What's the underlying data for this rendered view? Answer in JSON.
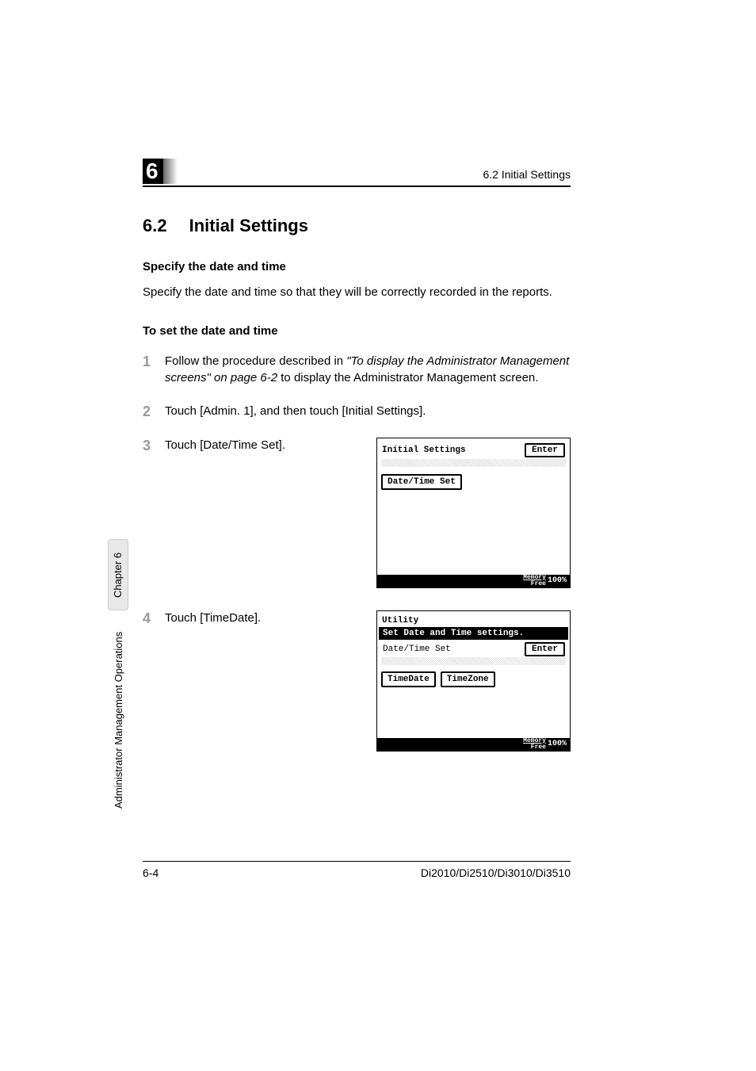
{
  "header": {
    "chapter_number": "6",
    "right_text": "6.2 Initial Settings"
  },
  "section": {
    "number": "6.2",
    "title": "Initial Settings"
  },
  "sub1": {
    "heading": "Specify the date and time",
    "text": "Specify the date and time so that they will be correctly recorded in the reports."
  },
  "sub2": {
    "heading": "To set the date and time"
  },
  "steps": {
    "s1": {
      "num": "1",
      "pre": "Follow the procedure described in ",
      "ital": "\"To display the Administrator Management screens\" on page 6-2",
      "post": " to display the Administrator Management screen."
    },
    "s2": {
      "num": "2",
      "text": "Touch [Admin. 1], and then touch [Initial Settings]."
    },
    "s3": {
      "num": "3",
      "text": "Touch [Date/Time Set]."
    },
    "s4": {
      "num": "4",
      "text": "Touch [TimeDate]."
    }
  },
  "lcd1": {
    "title": "Initial Settings",
    "enter": "Enter",
    "btn1": "Date/Time Set",
    "mem1": "Memory",
    "mem2": "Free",
    "pct": "100%"
  },
  "lcd2": {
    "title": "Utility",
    "bar": "Set Date and Time settings.",
    "subtitle": "Date/Time Set",
    "enter": "Enter",
    "btn1": "TimeDate",
    "btn2": "TimeZone",
    "mem1": "Memory",
    "mem2": "Free",
    "pct": "100%"
  },
  "sidetab": "Chapter 6",
  "sidelabel": "Administrator Management Operations",
  "footer": {
    "left": "6-4",
    "right": "Di2010/Di2510/Di3010/Di3510"
  }
}
